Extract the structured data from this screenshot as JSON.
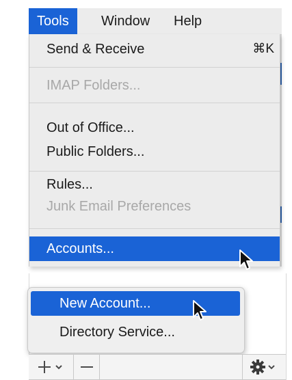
{
  "menubar": {
    "items": [
      {
        "label": "Tools",
        "active": true
      },
      {
        "label": "Window",
        "active": false
      },
      {
        "label": "Help",
        "active": false
      }
    ]
  },
  "tools_menu": {
    "send_receive": {
      "label": "Send & Receive",
      "shortcut": "⌘K",
      "enabled": true
    },
    "imap_folders": {
      "label": "IMAP Folders...",
      "enabled": false
    },
    "out_of_office": {
      "label": "Out of Office...",
      "enabled": true
    },
    "public_folders": {
      "label": "Public Folders...",
      "enabled": true
    },
    "rules": {
      "label": "Rules...",
      "enabled": true
    },
    "junk_email": {
      "label": "Junk Email Preferences",
      "enabled": false
    },
    "accounts": {
      "label": "Accounts...",
      "enabled": true,
      "highlighted": true
    }
  },
  "account_popup": {
    "new_account": {
      "label": "New Account...",
      "highlighted": true
    },
    "directory_service": {
      "label": "Directory Service...",
      "highlighted": false
    }
  },
  "bottom_toolbar": {
    "add_icon": "plus-with-chevron",
    "remove_icon": "minus",
    "settings_icon": "gear-with-chevron"
  },
  "colors": {
    "highlight": "#1a63d6",
    "menu_bg": "#ececec",
    "disabled_text": "#a8a8a8"
  }
}
